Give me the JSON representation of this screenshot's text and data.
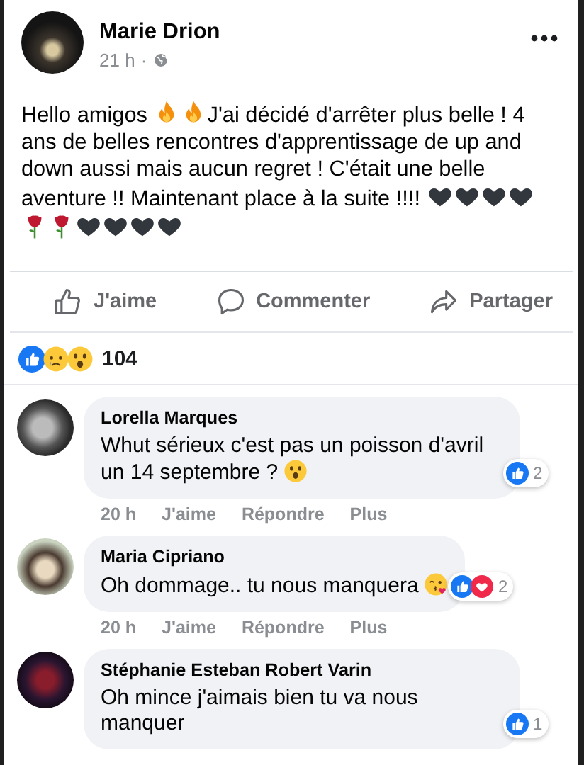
{
  "post": {
    "author": "Marie Drion",
    "time": "21 h",
    "separator": "·",
    "body": [
      {
        "kind": "text",
        "text": "Hello amigos "
      },
      {
        "kind": "fire"
      },
      {
        "kind": "fire"
      },
      {
        "kind": "text",
        "text": "J'ai décidé d'arrêter plus belle ! 4 ans de belles rencontres d'apprentissage de up and down aussi mais aucun regret ! C'était une belle aventure !! Maintenant place à la suite !!!! "
      },
      {
        "kind": "black-heart"
      },
      {
        "kind": "black-heart"
      },
      {
        "kind": "black-heart"
      },
      {
        "kind": "black-heart"
      },
      {
        "kind": "rose"
      },
      {
        "kind": "rose"
      },
      {
        "kind": "black-heart"
      },
      {
        "kind": "black-heart"
      },
      {
        "kind": "black-heart"
      },
      {
        "kind": "black-heart"
      }
    ],
    "actions": [
      {
        "kind": "like",
        "label": "J'aime"
      },
      {
        "kind": "comment",
        "label": "Commenter"
      },
      {
        "kind": "share",
        "label": "Partager"
      }
    ],
    "reactions": [
      {
        "kind": "like"
      },
      {
        "kind": "sad"
      },
      {
        "kind": "wow"
      }
    ],
    "reaction_count": "104"
  },
  "comments": [
    {
      "author": "Lorella Marques",
      "body": [
        {
          "kind": "text",
          "text": "Whut sérieux c'est pas un poisson d'avril un 14 septembre ? "
        },
        {
          "kind": "wow"
        }
      ],
      "reactions": [
        {
          "kind": "like"
        }
      ],
      "reaction_count": "2",
      "time": "20 h",
      "links": [
        "J'aime",
        "Répondre",
        "Plus"
      ]
    },
    {
      "author": "Maria Cipriano",
      "body": [
        {
          "kind": "text",
          "text": "Oh dommage.. tu nous manquera "
        },
        {
          "kind": "kiss"
        }
      ],
      "reactions": [
        {
          "kind": "like"
        },
        {
          "kind": "love"
        }
      ],
      "reaction_count": "2",
      "time": "20 h",
      "links": [
        "J'aime",
        "Répondre",
        "Plus"
      ]
    },
    {
      "author": "Stéphanie Esteban Robert Varin",
      "body": [
        {
          "kind": "text",
          "text": "Oh mince j'aimais bien tu va nous manquer"
        }
      ],
      "reactions": [
        {
          "kind": "like"
        }
      ],
      "reaction_count": "1"
    }
  ]
}
